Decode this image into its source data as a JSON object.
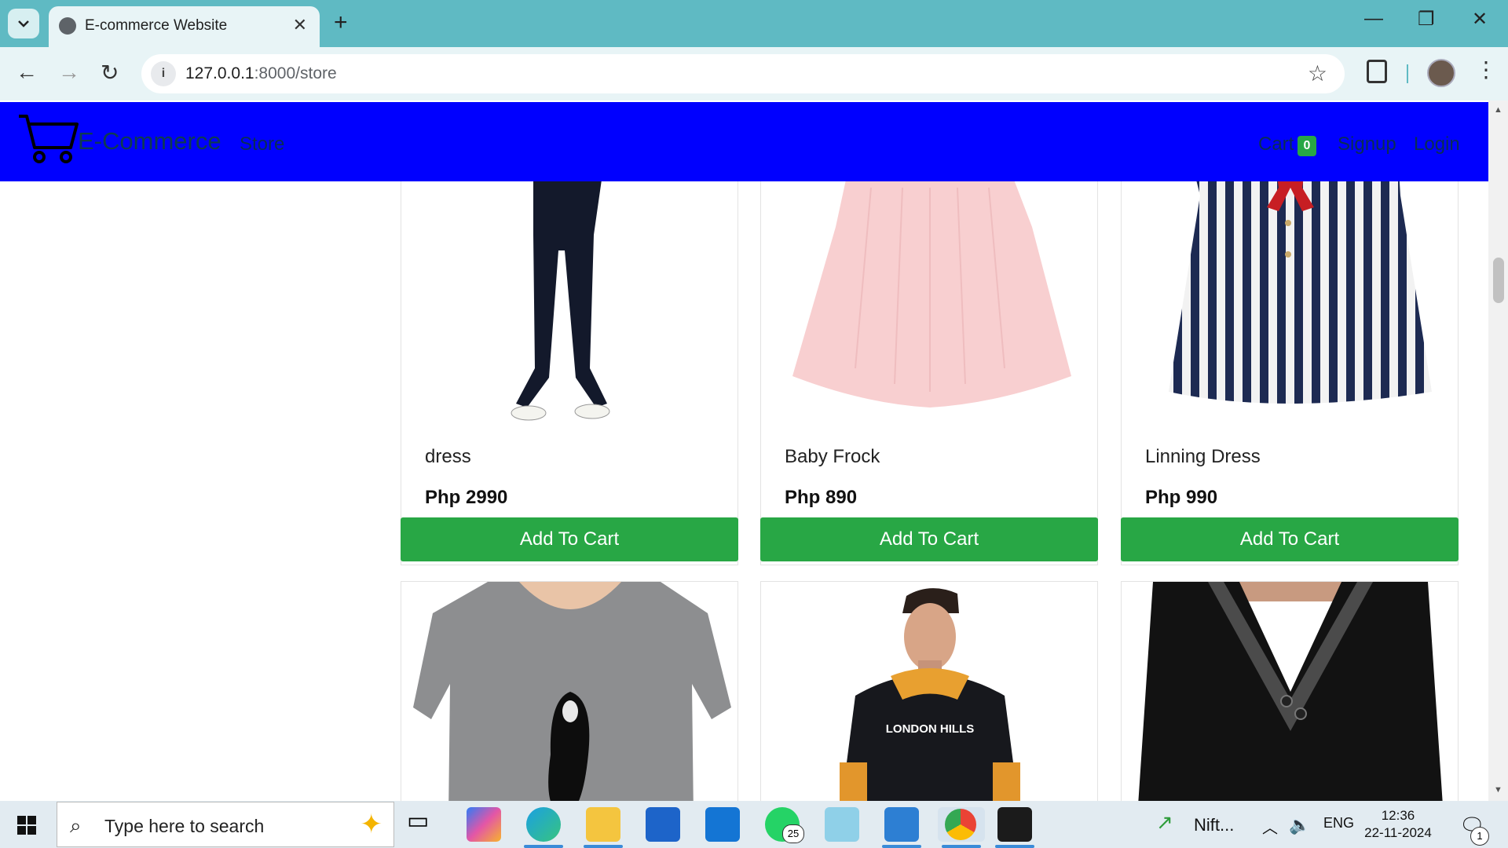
{
  "browser": {
    "tab_title": "E-commerce Website",
    "url_host": "127.0.0.1",
    "url_path": ":8000/store"
  },
  "navbar": {
    "brand": "E-Commerce",
    "store": "Store",
    "cart": "Cart",
    "cart_count": "0",
    "signup": "Signup",
    "login": "Login",
    "background_color": "#0000ff"
  },
  "products": [
    {
      "name": "dress",
      "price": "Php 2990",
      "button": "Add To Cart",
      "image": "dark-jeans-white-shoes"
    },
    {
      "name": "Baby Frock",
      "price": "Php 890",
      "button": "Add To Cart",
      "image": "pink-frock"
    },
    {
      "name": "Linning Dress",
      "price": "Php 990",
      "button": "Add To Cart",
      "image": "navy-white-striped-dress"
    },
    {
      "name": "",
      "price": "",
      "button": "",
      "image": "grey-penguin-tshirt"
    },
    {
      "name": "",
      "price": "",
      "button": "",
      "image": "black-hoodie"
    },
    {
      "name": "",
      "price": "",
      "button": "",
      "image": "black-shawl-collar-sweater"
    }
  ],
  "hoodie_print": "LONDON HILLS",
  "button_color": "#28a745",
  "taskbar": {
    "search_placeholder": "Type here to search",
    "whatsapp_badge": "25",
    "nifty_label": "Nift...",
    "language": "ENG",
    "time": "12:36",
    "date": "22-11-2024",
    "notification_count": "1"
  }
}
